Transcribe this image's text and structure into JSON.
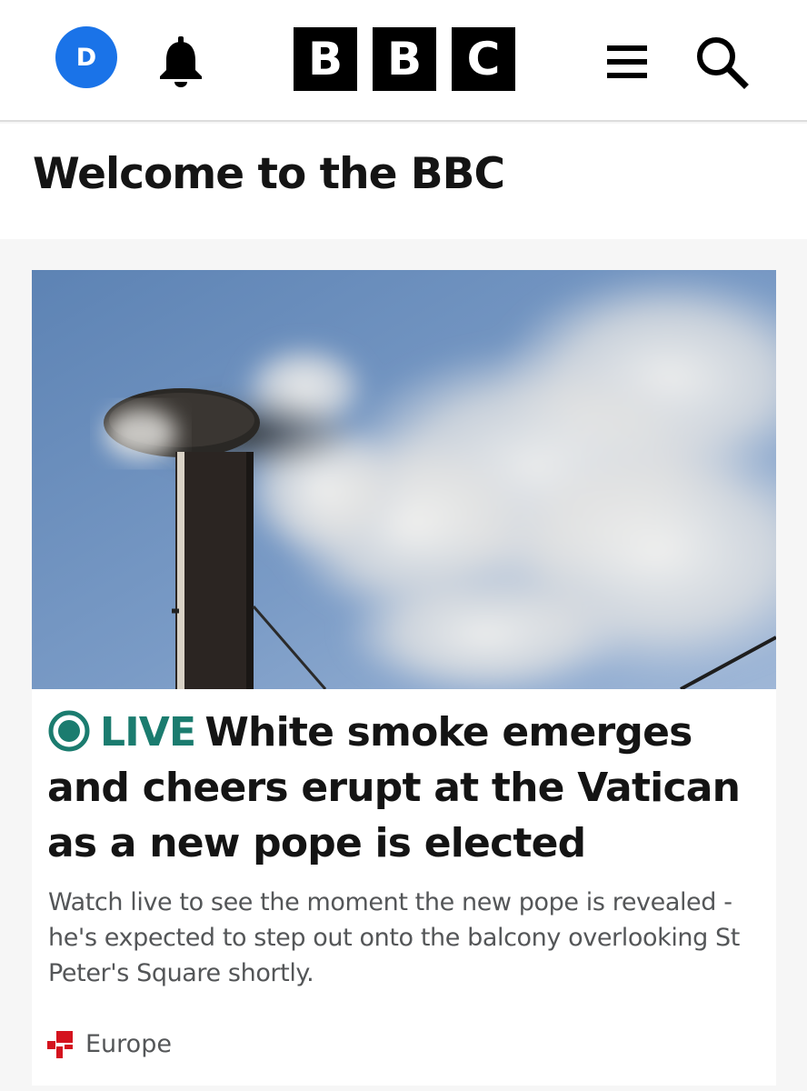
{
  "header": {
    "avatar_initial": "D",
    "notifications_icon": "bell-icon",
    "logo_letters": [
      "B",
      "B",
      "C"
    ],
    "menu_icon": "menu-icon",
    "search_icon": "search-icon",
    "colors": {
      "avatar_bg": "#1a73e8",
      "logo_bg": "#000000"
    }
  },
  "welcome": {
    "title": "Welcome to the BBC"
  },
  "story": {
    "image": "white-smoke-chimney-photo",
    "live_label": "LIVE",
    "headline": "White smoke emerges and cheers erupt at the Vatican as a new pope is elected",
    "summary": "Watch live to see the moment the new pope is revealed - he's expected to step out onto the balcony overlooking St Peter's Square shortly.",
    "topic": "Europe",
    "topic_icon": "red-squares-icon",
    "colors": {
      "live": "#1b7c6f",
      "topic_icon": "#d4131e"
    }
  }
}
